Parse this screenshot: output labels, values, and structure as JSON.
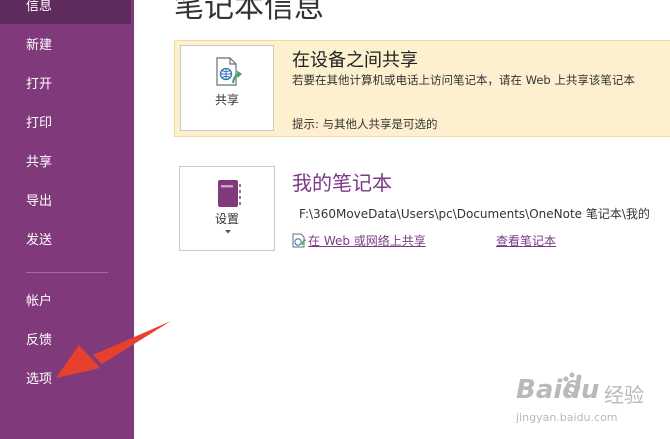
{
  "sidebar": {
    "items": [
      {
        "label": "信息"
      },
      {
        "label": "新建"
      },
      {
        "label": "打开"
      },
      {
        "label": "打印"
      },
      {
        "label": "共享"
      },
      {
        "label": "导出"
      },
      {
        "label": "发送"
      },
      {
        "label": "帐户"
      },
      {
        "label": "反馈"
      },
      {
        "label": "选项"
      }
    ]
  },
  "page": {
    "title": "笔记本信息"
  },
  "share_section": {
    "button_label": "共享",
    "title": "在设备之间共享",
    "description": "若要在其他计算机或电话上访问笔记本，请在 Web 上共享该笔记本",
    "tip": "提示: 与其他人共享是可选的"
  },
  "notebook": {
    "settings_label": "设置",
    "name": "我的笔记本",
    "path": "F:\\360MoveData\\Users\\pc\\Documents\\OneNote 笔记本\\我的",
    "share_link": "在 Web 或网络上共享",
    "view_link": "查看笔记本"
  },
  "watermark": {
    "brand": "Baidu",
    "suffix": "经验",
    "url": "jingyan.baidu.com"
  },
  "colors": {
    "sidebar": "#80397b",
    "sidebar_active": "#5f2a5c",
    "accent": "#7a3a85",
    "share_bg": "#fcf0cf",
    "arrow": "#e8402f"
  }
}
